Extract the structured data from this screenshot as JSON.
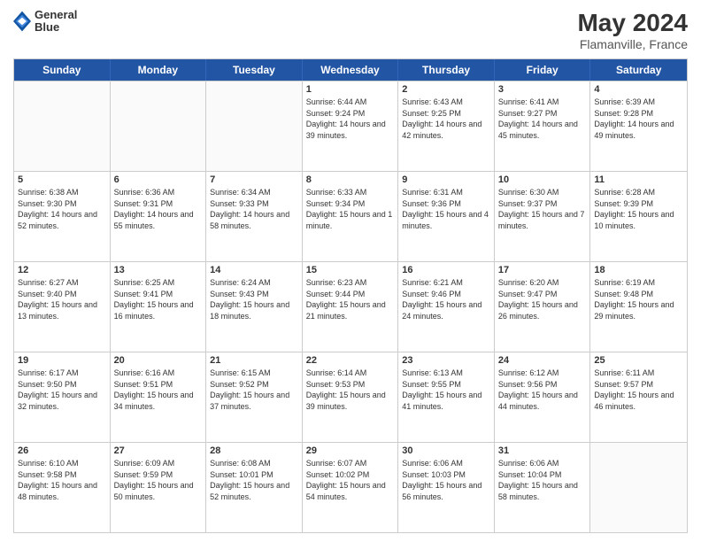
{
  "header": {
    "logo_line1": "General",
    "logo_line2": "Blue",
    "month_year": "May 2024",
    "location": "Flamanville, France"
  },
  "days_of_week": [
    "Sunday",
    "Monday",
    "Tuesday",
    "Wednesday",
    "Thursday",
    "Friday",
    "Saturday"
  ],
  "rows": [
    [
      {
        "day": "",
        "empty": true
      },
      {
        "day": "",
        "empty": true
      },
      {
        "day": "",
        "empty": true
      },
      {
        "day": "1",
        "sunrise": "6:44 AM",
        "sunset": "9:24 PM",
        "daylight": "14 hours and 39 minutes."
      },
      {
        "day": "2",
        "sunrise": "6:43 AM",
        "sunset": "9:25 PM",
        "daylight": "14 hours and 42 minutes."
      },
      {
        "day": "3",
        "sunrise": "6:41 AM",
        "sunset": "9:27 PM",
        "daylight": "14 hours and 45 minutes."
      },
      {
        "day": "4",
        "sunrise": "6:39 AM",
        "sunset": "9:28 PM",
        "daylight": "14 hours and 49 minutes."
      }
    ],
    [
      {
        "day": "5",
        "sunrise": "6:38 AM",
        "sunset": "9:30 PM",
        "daylight": "14 hours and 52 minutes."
      },
      {
        "day": "6",
        "sunrise": "6:36 AM",
        "sunset": "9:31 PM",
        "daylight": "14 hours and 55 minutes."
      },
      {
        "day": "7",
        "sunrise": "6:34 AM",
        "sunset": "9:33 PM",
        "daylight": "14 hours and 58 minutes."
      },
      {
        "day": "8",
        "sunrise": "6:33 AM",
        "sunset": "9:34 PM",
        "daylight": "15 hours and 1 minute."
      },
      {
        "day": "9",
        "sunrise": "6:31 AM",
        "sunset": "9:36 PM",
        "daylight": "15 hours and 4 minutes."
      },
      {
        "day": "10",
        "sunrise": "6:30 AM",
        "sunset": "9:37 PM",
        "daylight": "15 hours and 7 minutes."
      },
      {
        "day": "11",
        "sunrise": "6:28 AM",
        "sunset": "9:39 PM",
        "daylight": "15 hours and 10 minutes."
      }
    ],
    [
      {
        "day": "12",
        "sunrise": "6:27 AM",
        "sunset": "9:40 PM",
        "daylight": "15 hours and 13 minutes."
      },
      {
        "day": "13",
        "sunrise": "6:25 AM",
        "sunset": "9:41 PM",
        "daylight": "15 hours and 16 minutes."
      },
      {
        "day": "14",
        "sunrise": "6:24 AM",
        "sunset": "9:43 PM",
        "daylight": "15 hours and 18 minutes."
      },
      {
        "day": "15",
        "sunrise": "6:23 AM",
        "sunset": "9:44 PM",
        "daylight": "15 hours and 21 minutes."
      },
      {
        "day": "16",
        "sunrise": "6:21 AM",
        "sunset": "9:46 PM",
        "daylight": "15 hours and 24 minutes."
      },
      {
        "day": "17",
        "sunrise": "6:20 AM",
        "sunset": "9:47 PM",
        "daylight": "15 hours and 26 minutes."
      },
      {
        "day": "18",
        "sunrise": "6:19 AM",
        "sunset": "9:48 PM",
        "daylight": "15 hours and 29 minutes."
      }
    ],
    [
      {
        "day": "19",
        "sunrise": "6:17 AM",
        "sunset": "9:50 PM",
        "daylight": "15 hours and 32 minutes."
      },
      {
        "day": "20",
        "sunrise": "6:16 AM",
        "sunset": "9:51 PM",
        "daylight": "15 hours and 34 minutes."
      },
      {
        "day": "21",
        "sunrise": "6:15 AM",
        "sunset": "9:52 PM",
        "daylight": "15 hours and 37 minutes."
      },
      {
        "day": "22",
        "sunrise": "6:14 AM",
        "sunset": "9:53 PM",
        "daylight": "15 hours and 39 minutes."
      },
      {
        "day": "23",
        "sunrise": "6:13 AM",
        "sunset": "9:55 PM",
        "daylight": "15 hours and 41 minutes."
      },
      {
        "day": "24",
        "sunrise": "6:12 AM",
        "sunset": "9:56 PM",
        "daylight": "15 hours and 44 minutes."
      },
      {
        "day": "25",
        "sunrise": "6:11 AM",
        "sunset": "9:57 PM",
        "daylight": "15 hours and 46 minutes."
      }
    ],
    [
      {
        "day": "26",
        "sunrise": "6:10 AM",
        "sunset": "9:58 PM",
        "daylight": "15 hours and 48 minutes."
      },
      {
        "day": "27",
        "sunrise": "6:09 AM",
        "sunset": "9:59 PM",
        "daylight": "15 hours and 50 minutes."
      },
      {
        "day": "28",
        "sunrise": "6:08 AM",
        "sunset": "10:01 PM",
        "daylight": "15 hours and 52 minutes."
      },
      {
        "day": "29",
        "sunrise": "6:07 AM",
        "sunset": "10:02 PM",
        "daylight": "15 hours and 54 minutes."
      },
      {
        "day": "30",
        "sunrise": "6:06 AM",
        "sunset": "10:03 PM",
        "daylight": "15 hours and 56 minutes."
      },
      {
        "day": "31",
        "sunrise": "6:06 AM",
        "sunset": "10:04 PM",
        "daylight": "15 hours and 58 minutes."
      },
      {
        "day": "",
        "empty": true
      }
    ]
  ],
  "labels": {
    "sunrise_prefix": "Sunrise: ",
    "sunset_prefix": "Sunset: ",
    "daylight_prefix": "Daylight: "
  }
}
